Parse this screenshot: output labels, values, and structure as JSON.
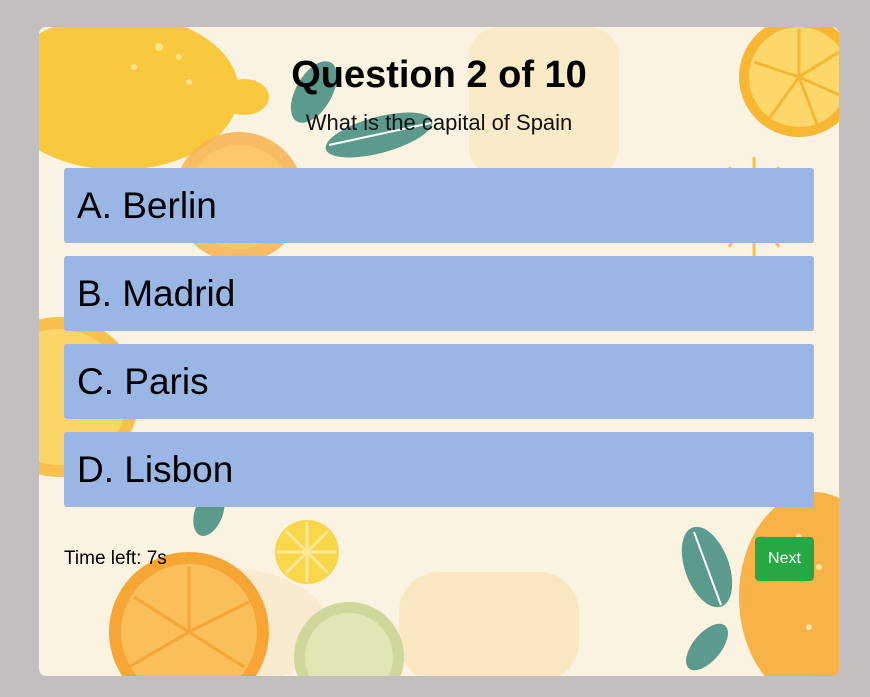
{
  "quiz": {
    "title": "Question 2 of 10",
    "question": "What is the capital of Spain",
    "options": [
      {
        "label": "A. Berlin"
      },
      {
        "label": "B. Madrid"
      },
      {
        "label": "C. Paris"
      },
      {
        "label": "D. Lisbon"
      }
    ],
    "timer_text": "Time left: 7s",
    "next_label": "Next"
  },
  "colors": {
    "option_bg": "#99b6e5",
    "next_button": "#28a745",
    "page_bg": "#c4bfbf",
    "card_bg": "#fbf3e2"
  },
  "background_icons": [
    "lemon-icon",
    "lemon-slice-icon",
    "leaf-icon"
  ]
}
